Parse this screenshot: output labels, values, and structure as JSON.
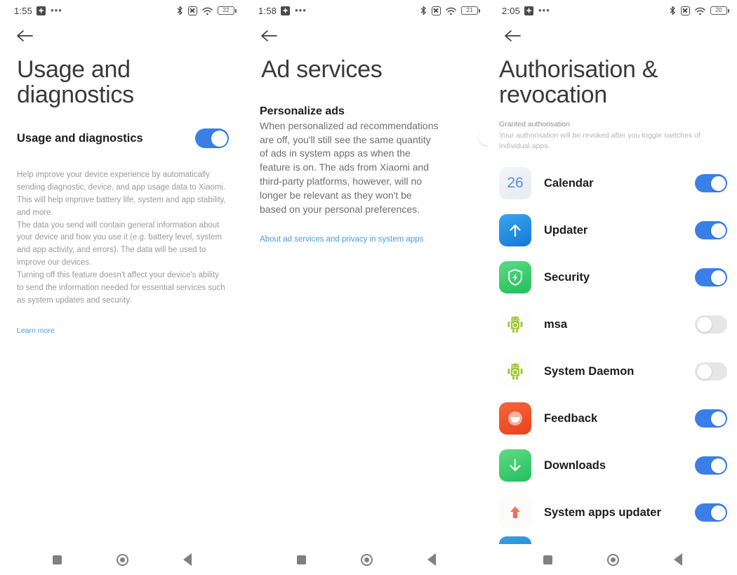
{
  "screens": [
    {
      "id": "usage-and-diagnostics",
      "statusbar": {
        "time": "1:55",
        "battery_level": "22",
        "icons": [
          "app-badge-icon",
          "more-dots-icon",
          "bluetooth-icon",
          "alarm-off-icon",
          "wifi-icon",
          "battery-icon"
        ]
      },
      "title": "Usage and diagnostics",
      "setting_label": "Usage and diagnostics",
      "setting_enabled": true,
      "description": "Help improve your device experience by automatically sending diagnostic, device, and app usage data to Xiaomi. This will help improve battery life, system and app stability, and more.\nThe data you send will contain general information about your device and how you use it (e.g. battery level, system and app activity, and errors). The data will be used to improve our devices.\nTurning off this feature doesn't affect your device's ability to send the information needed for essential services such as system updates and security.",
      "link": "Learn more"
    },
    {
      "id": "ad-services",
      "statusbar": {
        "time": "1:58",
        "battery_level": "21"
      },
      "title": "Ad services",
      "setting_label": "Personalize ads",
      "setting_enabled": false,
      "description": "When personalized ad recommendations are off, you'll still see the same quantity of ads in system apps as when the feature is on. The ads from Xiaomi and third-party platforms, however, will no longer be relevant as they won't be based on your personal preferences.",
      "link": "About ad services and privacy in system apps"
    },
    {
      "id": "authorisation-and-revocation",
      "statusbar": {
        "time": "2:05",
        "battery_level": "20"
      },
      "title": "Authorisation & revocation",
      "section_header": "Granted authorisation",
      "section_subtext": "Your authorisation will be revoked after you toggle switches of individual apps.",
      "apps": [
        {
          "name": "Calendar",
          "icon": "calendar-icon",
          "icon_text": "26",
          "enabled": true
        },
        {
          "name": "Updater",
          "icon": "updater-arrow-up-icon",
          "enabled": true
        },
        {
          "name": "Security",
          "icon": "security-shield-icon",
          "enabled": true
        },
        {
          "name": "msa",
          "icon": "android-robot-icon",
          "enabled": false
        },
        {
          "name": "System Daemon",
          "icon": "android-robot-icon",
          "enabled": false
        },
        {
          "name": "Feedback",
          "icon": "feedback-smile-icon",
          "enabled": true
        },
        {
          "name": "Downloads",
          "icon": "downloads-arrow-down-icon",
          "enabled": true
        },
        {
          "name": "System apps updater",
          "icon": "system-apps-updater-arrow-icon",
          "enabled": true
        }
      ]
    }
  ],
  "navbar": {
    "recents": "recents-square-icon",
    "home": "home-circle-icon",
    "back": "back-triangle-icon"
  },
  "colors": {
    "switch_on": "#3a7fe8",
    "switch_off": "#e6e6e6",
    "link": "#4a9bdc",
    "title": "#3a3a3a",
    "body": "#9a9a9a"
  }
}
